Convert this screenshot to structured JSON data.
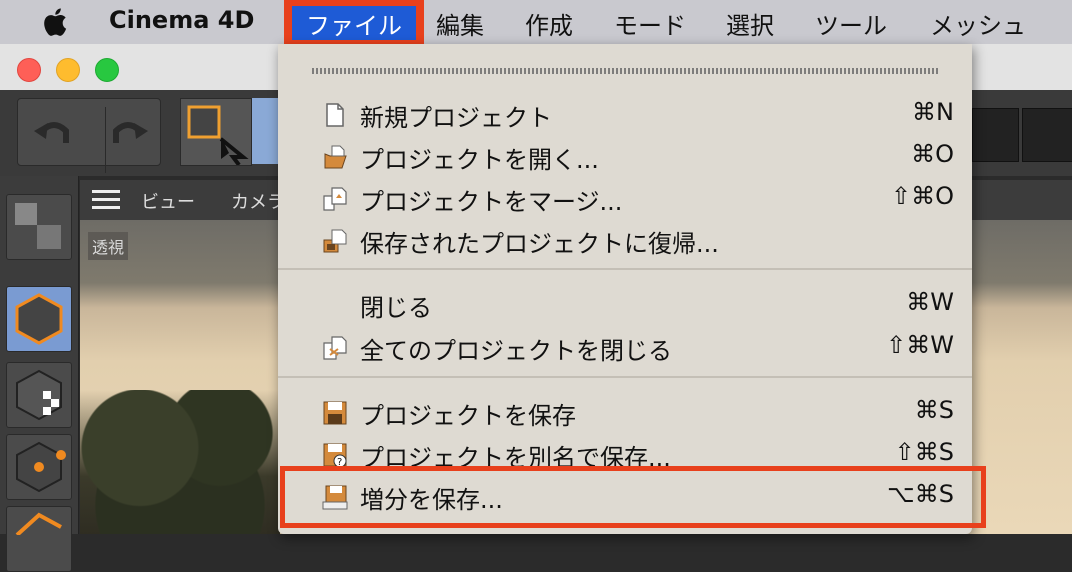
{
  "menubar": {
    "app_name": "Cinema 4D",
    "items": [
      "ファイル",
      "編集",
      "作成",
      "モード",
      "選択",
      "ツール",
      "メッシュ"
    ]
  },
  "viewport": {
    "menu_view": "ビュー",
    "menu_camera": "カメラ",
    "label": "透視"
  },
  "file_menu": {
    "items": [
      {
        "label": "新規プロジェクト",
        "shortcut": "⌘N",
        "icon": "new-document-icon"
      },
      {
        "label": "プロジェクトを開く...",
        "shortcut": "⌘O",
        "icon": "open-folder-icon"
      },
      {
        "label": "プロジェクトをマージ...",
        "shortcut": "⇧⌘O",
        "icon": "merge-icon"
      },
      {
        "label": "保存されたプロジェクトに復帰...",
        "shortcut": "",
        "icon": "revert-icon"
      },
      {
        "label": "閉じる",
        "shortcut": "⌘W",
        "icon": ""
      },
      {
        "label": "全てのプロジェクトを閉じる",
        "shortcut": "⇧⌘W",
        "icon": "close-all-icon"
      },
      {
        "label": "プロジェクトを保存",
        "shortcut": "⌘S",
        "icon": "save-icon"
      },
      {
        "label": "プロジェクトを別名で保存...",
        "shortcut": "⇧⌘S",
        "icon": "save-as-icon"
      },
      {
        "label": "増分を保存...",
        "shortcut": "⌥⌘S",
        "icon": "save-incremental-icon"
      }
    ]
  },
  "colors": {
    "highlight": "#e8401c",
    "menu_selected": "#1e5bd6",
    "menu_bg": "#dedad2"
  }
}
